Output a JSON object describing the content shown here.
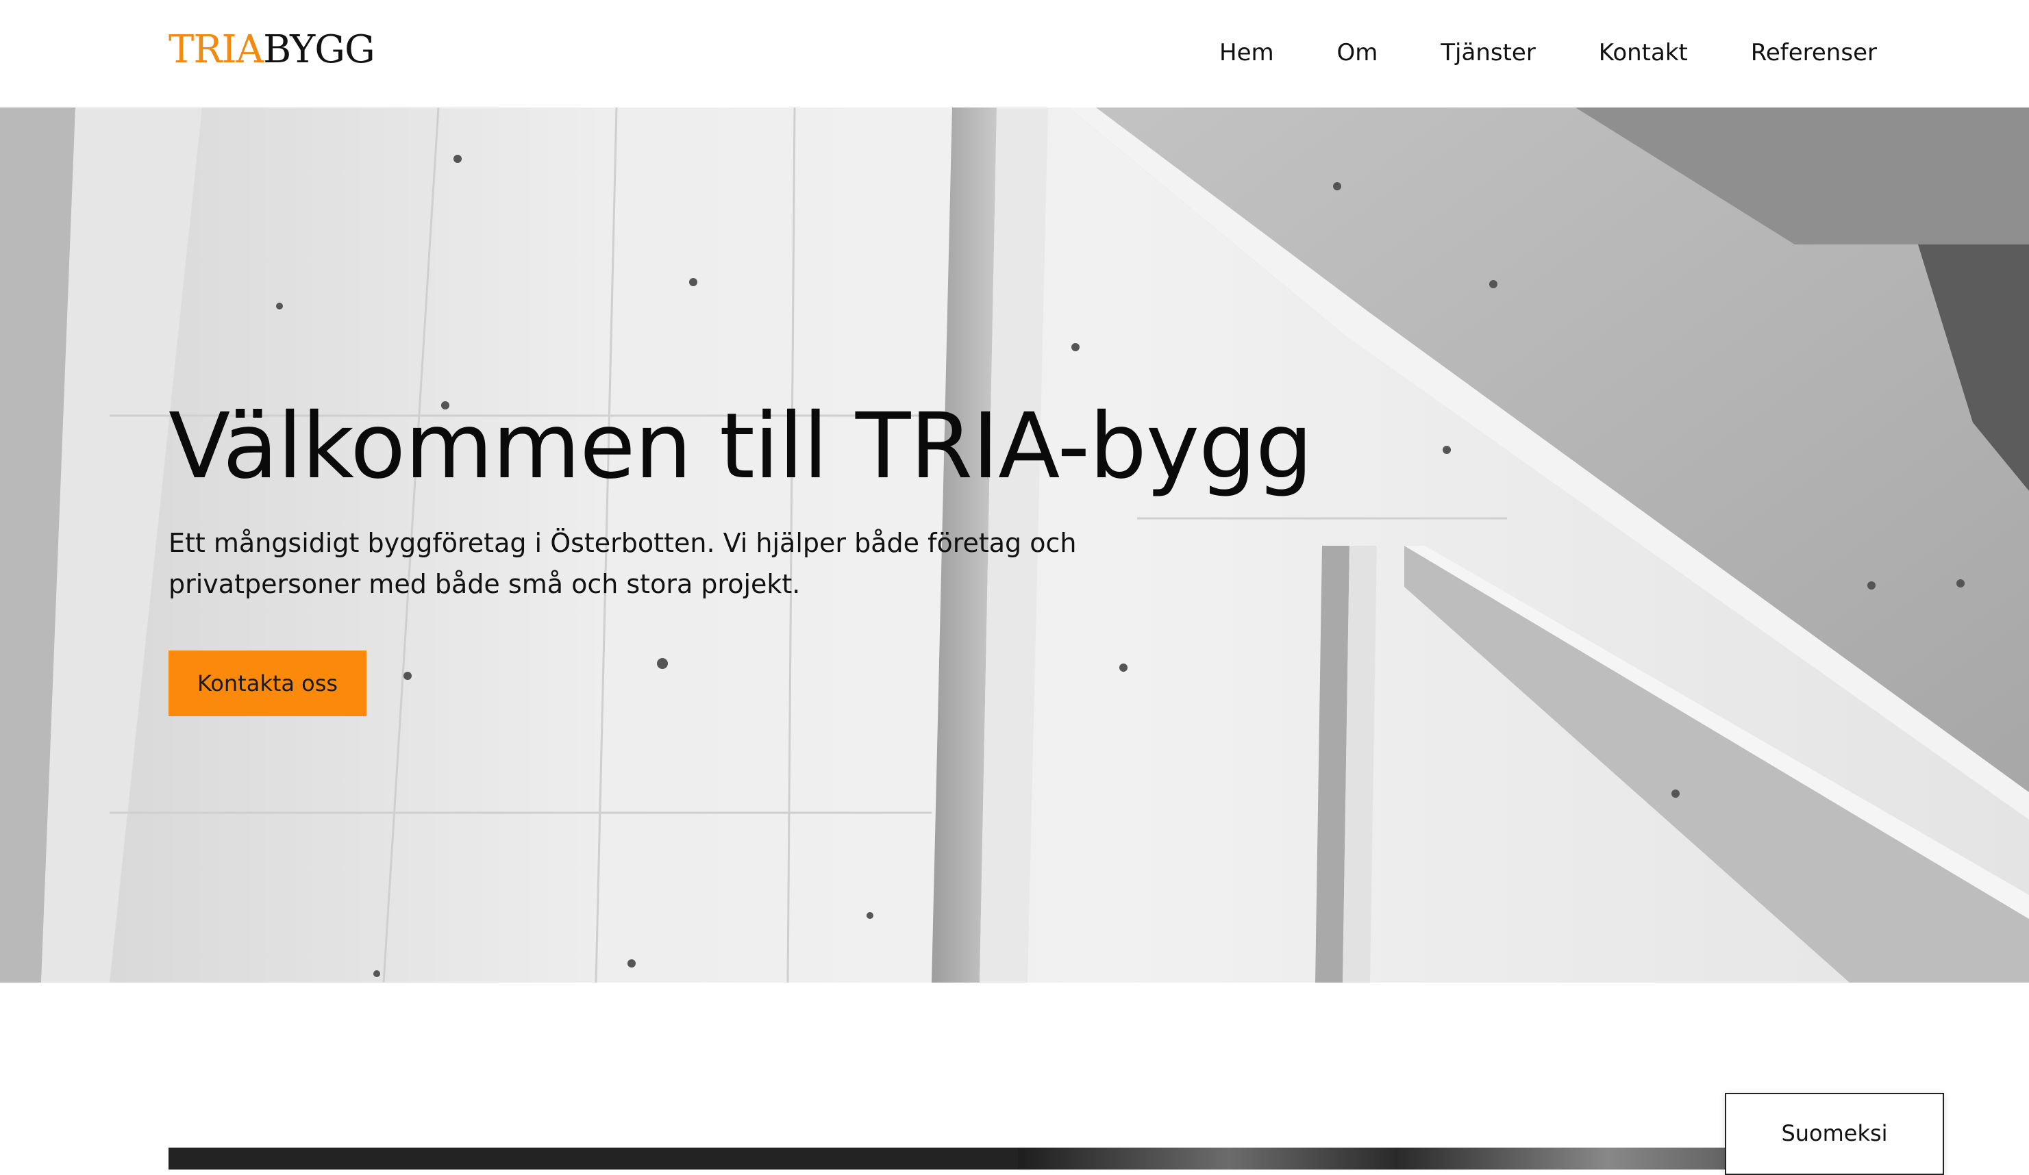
{
  "brand": {
    "logo_part1": "TRIA",
    "logo_part2": "BYGG",
    "accent_color": "#fb8a0c"
  },
  "nav": {
    "items": [
      {
        "label": "Hem"
      },
      {
        "label": "Om"
      },
      {
        "label": "Tjänster"
      },
      {
        "label": "Kontakt"
      },
      {
        "label": "Referenser"
      }
    ]
  },
  "hero": {
    "title": "Välkommen till TRIA-bygg",
    "subtitle_line1": "Ett mångsidigt byggföretag i Österbotten. Vi hjälper både företag och",
    "subtitle_line2": "privatpersoner med både små och stora projekt.",
    "cta_label": "Kontakta oss",
    "background": "grayscale concrete wall and staircase photo"
  },
  "language_switch": {
    "label": "Suomeksi"
  }
}
